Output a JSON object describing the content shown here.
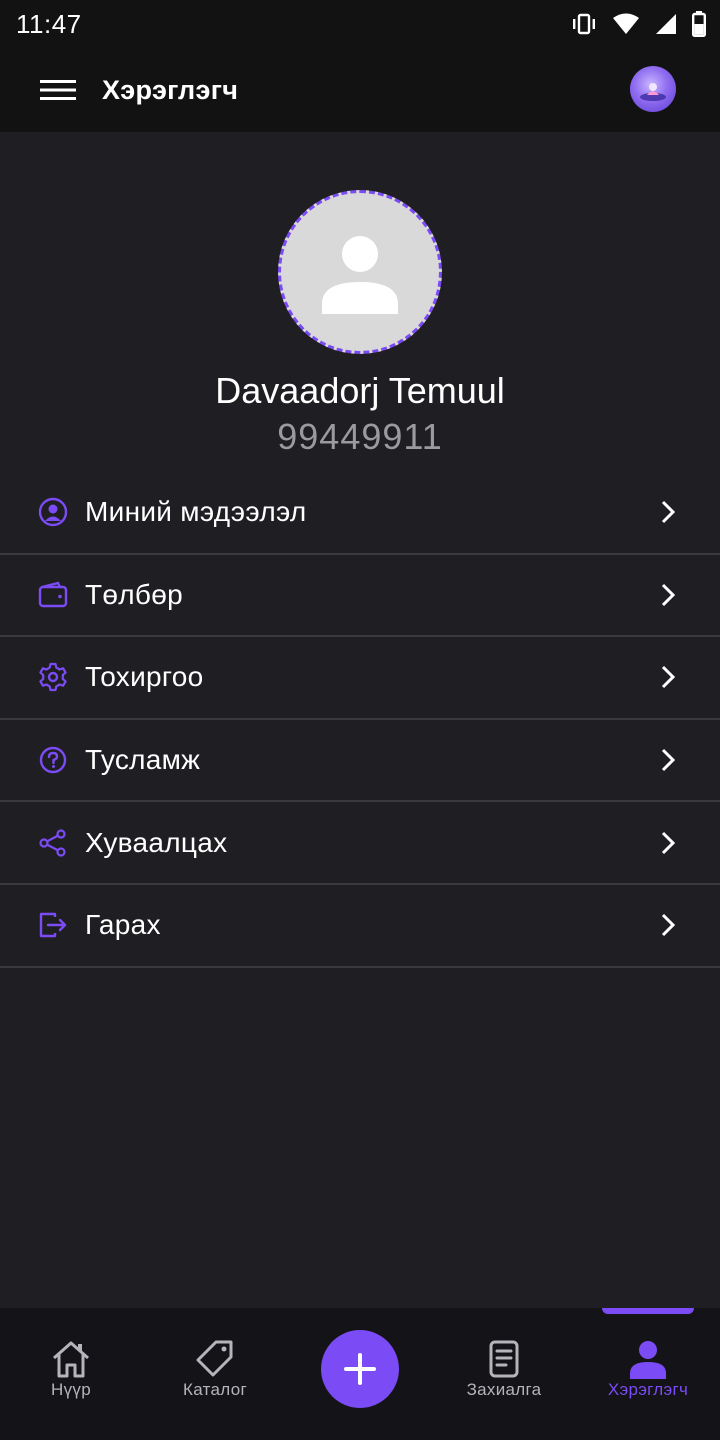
{
  "status_bar": {
    "time": "11:47",
    "icons": [
      "vibrate-icon",
      "wifi-icon",
      "signal-icon",
      "battery-icon"
    ]
  },
  "app_bar": {
    "title": "Хэрэглэгч",
    "menu_icon": "hamburger-menu-icon",
    "avatar": "user-avatar"
  },
  "profile": {
    "name": "Davaadorj Temuul",
    "phone": "99449911",
    "avatar_placeholder_icon": "person-icon"
  },
  "menu": {
    "items": [
      {
        "label": "Миний мэдээлэл",
        "icon": "user-circle-icon"
      },
      {
        "label": "Төлбөр",
        "icon": "wallet-icon"
      },
      {
        "label": "Тохиргоо",
        "icon": "gear-icon"
      },
      {
        "label": "Тусламж",
        "icon": "help-circle-icon"
      },
      {
        "label": "Хуваалцах",
        "icon": "share-icon"
      },
      {
        "label": "Гарах",
        "icon": "logout-icon"
      }
    ]
  },
  "bottom_nav": {
    "items": [
      {
        "label": "Нүүр",
        "icon": "home-icon",
        "active": false
      },
      {
        "label": "Каталог",
        "icon": "tag-icon",
        "active": false
      },
      {
        "label": "Захиалга",
        "icon": "document-icon",
        "active": false
      },
      {
        "label": "Хэрэглэгч",
        "icon": "person-icon",
        "active": true
      }
    ],
    "fab_icon": "plus-icon"
  },
  "colors": {
    "accent": "#7b4cf5",
    "background": "#1f1e23",
    "bar": "#121212",
    "divider": "#3a393e",
    "secondary_text": "#9a9a9f"
  }
}
